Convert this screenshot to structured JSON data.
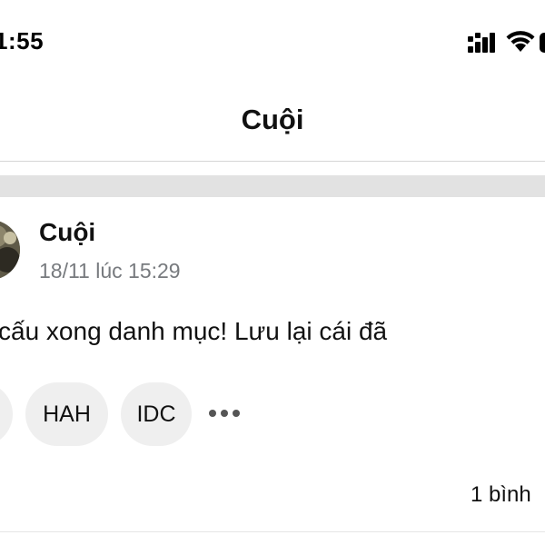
{
  "status_bar": {
    "time": "1:55",
    "icons": [
      "cellular-signal-icon",
      "wifi-icon",
      "battery-icon"
    ]
  },
  "header": {
    "title": "Cuội"
  },
  "post": {
    "author": "Cuội",
    "timestamp": "18/11 lúc 15:29",
    "text": "cấu xong danh mục! Lưu lại cái đã",
    "tags": [
      "HAH",
      "IDC"
    ],
    "more_icon": "more-horizontal-icon",
    "comment_count": "1 bình"
  },
  "colors": {
    "background": "#ffffff",
    "text": "#111111",
    "secondary_text": "#777a7e",
    "chip_background": "#efefef",
    "section_gap": "#e2e2e2"
  }
}
